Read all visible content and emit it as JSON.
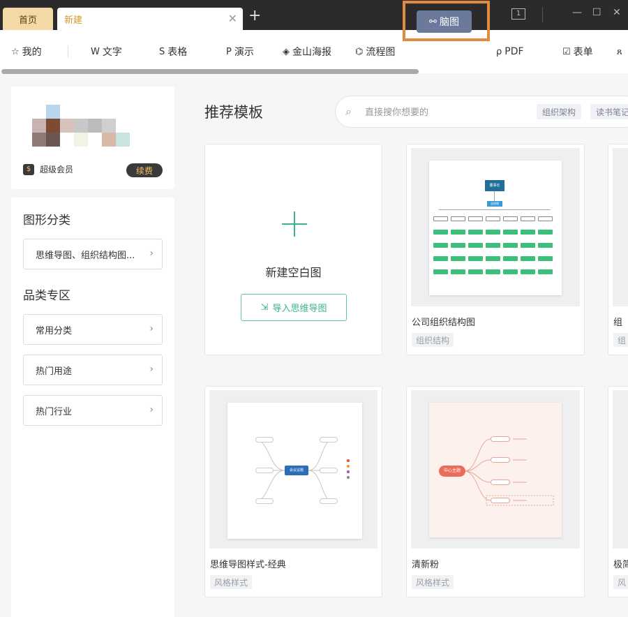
{
  "tabs": {
    "home": "首页",
    "new": "新建"
  },
  "window": {
    "page_indicator": "1"
  },
  "toolbar": {
    "items": [
      {
        "label": "我的",
        "icon": "star-icon"
      },
      {
        "label": "文字",
        "icon": "w-icon"
      },
      {
        "label": "表格",
        "icon": "s-icon"
      },
      {
        "label": "演示",
        "icon": "p-icon"
      },
      {
        "label": "金山海报",
        "icon": "poster-icon"
      },
      {
        "label": "流程图",
        "icon": "flowchart-icon"
      },
      {
        "label": "脑图",
        "icon": "mindmap-icon"
      },
      {
        "label": "PDF",
        "icon": "pdf-icon"
      },
      {
        "label": "表单",
        "icon": "form-icon"
      }
    ]
  },
  "profile": {
    "member_label": "超级会员",
    "renew_label": "续费"
  },
  "sidebar": {
    "graphic_heading": "图形分类",
    "graphic_select": "思维导图、组织结构图...",
    "category_heading": "品类专区",
    "categories": [
      "常用分类",
      "热门用途",
      "热门行业"
    ]
  },
  "main": {
    "title": "推荐模板",
    "search_placeholder": "直接搜你想要的",
    "search_chips": [
      "组织架构",
      "读书笔记"
    ],
    "blank": {
      "title": "新建空白图",
      "import_label": "导入思维导图"
    },
    "templates": [
      {
        "name": "公司组织结构图",
        "tag": "组织结构"
      },
      {
        "name": "组",
        "tag": "组"
      },
      {
        "name": "思维导图样式-经典",
        "tag": "风格样式"
      },
      {
        "name": "清新粉",
        "tag": "风格样式"
      },
      {
        "name": "极简",
        "tag": "风"
      }
    ],
    "thumb_org": {
      "root": "董事长",
      "second": "总经理"
    },
    "thumb_classic": {
      "center": "会议议题"
    },
    "thumb_pink": {
      "center": "中心主题"
    }
  },
  "colors": {
    "accent_green": "#39b58a",
    "highlight_orange": "#e28b3f",
    "active_tab": "#6b7a9a",
    "tab_gold": "#d49a2c"
  }
}
